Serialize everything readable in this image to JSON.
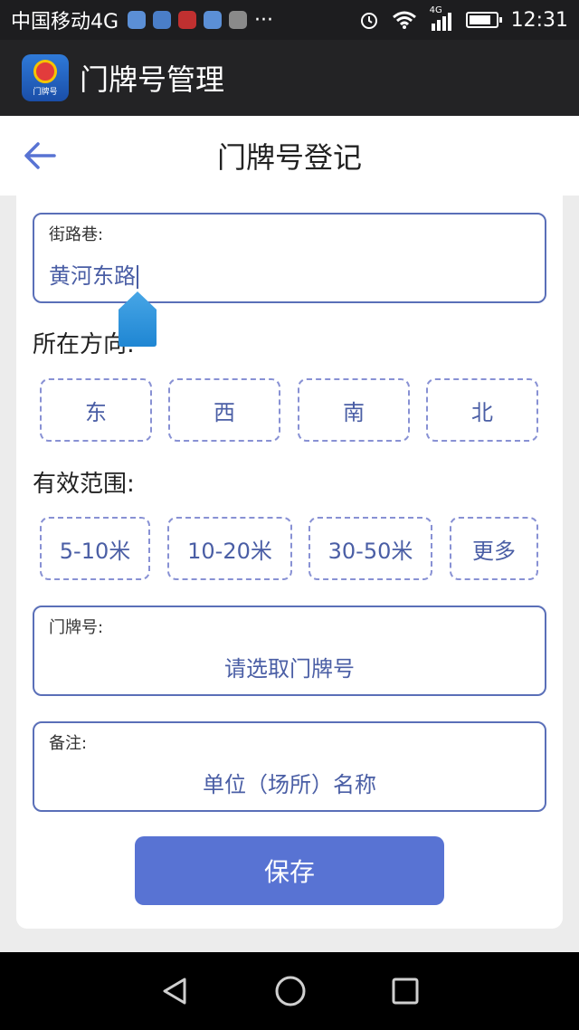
{
  "status_bar": {
    "carrier": "中国移动4G",
    "dots": "···",
    "network": "4G",
    "time": "12:31",
    "battery_level": 0.85
  },
  "app_bar": {
    "logo_text": "门牌号",
    "title": "门牌号管理"
  },
  "page": {
    "title": "门牌号登记"
  },
  "street_field": {
    "label": "街路巷:",
    "value": "黄河东路"
  },
  "direction": {
    "title": "所在方向:",
    "options": [
      "东",
      "西",
      "南",
      "北"
    ]
  },
  "range": {
    "title": "有效范围:",
    "options": [
      "5-10米",
      "10-20米",
      "30-50米",
      "更多"
    ]
  },
  "number_field": {
    "label": "门牌号:",
    "placeholder": "请选取门牌号"
  },
  "note_field": {
    "label": "备注:",
    "placeholder": "单位（场所）名称"
  },
  "save_label": "保存",
  "colors": {
    "accent": "#5873d3",
    "border": "#5a6fb8",
    "text_accent": "#4a5ea5"
  },
  "icons": [
    "back-arrow-icon",
    "wifi-icon",
    "signal-icon",
    "battery-icon",
    "alarm-icon",
    "back-nav-icon",
    "home-nav-icon",
    "recents-nav-icon"
  ]
}
